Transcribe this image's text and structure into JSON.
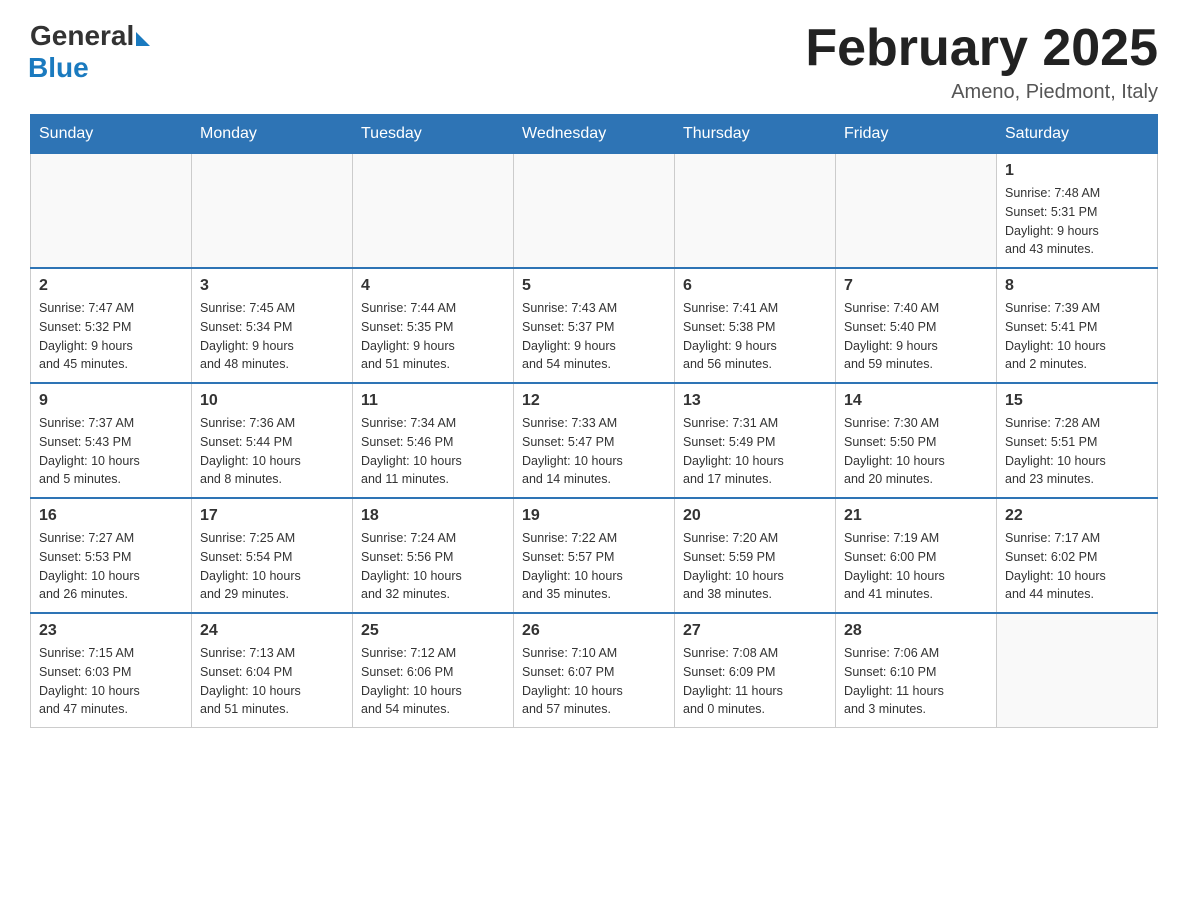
{
  "logo": {
    "general": "General",
    "blue": "Blue"
  },
  "title": "February 2025",
  "location": "Ameno, Piedmont, Italy",
  "weekdays": [
    "Sunday",
    "Monday",
    "Tuesday",
    "Wednesday",
    "Thursday",
    "Friday",
    "Saturday"
  ],
  "weeks": [
    [
      {
        "day": "",
        "info": ""
      },
      {
        "day": "",
        "info": ""
      },
      {
        "day": "",
        "info": ""
      },
      {
        "day": "",
        "info": ""
      },
      {
        "day": "",
        "info": ""
      },
      {
        "day": "",
        "info": ""
      },
      {
        "day": "1",
        "info": "Sunrise: 7:48 AM\nSunset: 5:31 PM\nDaylight: 9 hours\nand 43 minutes."
      }
    ],
    [
      {
        "day": "2",
        "info": "Sunrise: 7:47 AM\nSunset: 5:32 PM\nDaylight: 9 hours\nand 45 minutes."
      },
      {
        "day": "3",
        "info": "Sunrise: 7:45 AM\nSunset: 5:34 PM\nDaylight: 9 hours\nand 48 minutes."
      },
      {
        "day": "4",
        "info": "Sunrise: 7:44 AM\nSunset: 5:35 PM\nDaylight: 9 hours\nand 51 minutes."
      },
      {
        "day": "5",
        "info": "Sunrise: 7:43 AM\nSunset: 5:37 PM\nDaylight: 9 hours\nand 54 minutes."
      },
      {
        "day": "6",
        "info": "Sunrise: 7:41 AM\nSunset: 5:38 PM\nDaylight: 9 hours\nand 56 minutes."
      },
      {
        "day": "7",
        "info": "Sunrise: 7:40 AM\nSunset: 5:40 PM\nDaylight: 9 hours\nand 59 minutes."
      },
      {
        "day": "8",
        "info": "Sunrise: 7:39 AM\nSunset: 5:41 PM\nDaylight: 10 hours\nand 2 minutes."
      }
    ],
    [
      {
        "day": "9",
        "info": "Sunrise: 7:37 AM\nSunset: 5:43 PM\nDaylight: 10 hours\nand 5 minutes."
      },
      {
        "day": "10",
        "info": "Sunrise: 7:36 AM\nSunset: 5:44 PM\nDaylight: 10 hours\nand 8 minutes."
      },
      {
        "day": "11",
        "info": "Sunrise: 7:34 AM\nSunset: 5:46 PM\nDaylight: 10 hours\nand 11 minutes."
      },
      {
        "day": "12",
        "info": "Sunrise: 7:33 AM\nSunset: 5:47 PM\nDaylight: 10 hours\nand 14 minutes."
      },
      {
        "day": "13",
        "info": "Sunrise: 7:31 AM\nSunset: 5:49 PM\nDaylight: 10 hours\nand 17 minutes."
      },
      {
        "day": "14",
        "info": "Sunrise: 7:30 AM\nSunset: 5:50 PM\nDaylight: 10 hours\nand 20 minutes."
      },
      {
        "day": "15",
        "info": "Sunrise: 7:28 AM\nSunset: 5:51 PM\nDaylight: 10 hours\nand 23 minutes."
      }
    ],
    [
      {
        "day": "16",
        "info": "Sunrise: 7:27 AM\nSunset: 5:53 PM\nDaylight: 10 hours\nand 26 minutes."
      },
      {
        "day": "17",
        "info": "Sunrise: 7:25 AM\nSunset: 5:54 PM\nDaylight: 10 hours\nand 29 minutes."
      },
      {
        "day": "18",
        "info": "Sunrise: 7:24 AM\nSunset: 5:56 PM\nDaylight: 10 hours\nand 32 minutes."
      },
      {
        "day": "19",
        "info": "Sunrise: 7:22 AM\nSunset: 5:57 PM\nDaylight: 10 hours\nand 35 minutes."
      },
      {
        "day": "20",
        "info": "Sunrise: 7:20 AM\nSunset: 5:59 PM\nDaylight: 10 hours\nand 38 minutes."
      },
      {
        "day": "21",
        "info": "Sunrise: 7:19 AM\nSunset: 6:00 PM\nDaylight: 10 hours\nand 41 minutes."
      },
      {
        "day": "22",
        "info": "Sunrise: 7:17 AM\nSunset: 6:02 PM\nDaylight: 10 hours\nand 44 minutes."
      }
    ],
    [
      {
        "day": "23",
        "info": "Sunrise: 7:15 AM\nSunset: 6:03 PM\nDaylight: 10 hours\nand 47 minutes."
      },
      {
        "day": "24",
        "info": "Sunrise: 7:13 AM\nSunset: 6:04 PM\nDaylight: 10 hours\nand 51 minutes."
      },
      {
        "day": "25",
        "info": "Sunrise: 7:12 AM\nSunset: 6:06 PM\nDaylight: 10 hours\nand 54 minutes."
      },
      {
        "day": "26",
        "info": "Sunrise: 7:10 AM\nSunset: 6:07 PM\nDaylight: 10 hours\nand 57 minutes."
      },
      {
        "day": "27",
        "info": "Sunrise: 7:08 AM\nSunset: 6:09 PM\nDaylight: 11 hours\nand 0 minutes."
      },
      {
        "day": "28",
        "info": "Sunrise: 7:06 AM\nSunset: 6:10 PM\nDaylight: 11 hours\nand 3 minutes."
      },
      {
        "day": "",
        "info": ""
      }
    ]
  ]
}
